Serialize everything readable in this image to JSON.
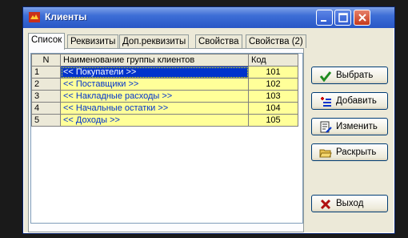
{
  "window": {
    "title": "Клиенты"
  },
  "tabs": [
    {
      "label": "Список"
    },
    {
      "label": "Реквизиты"
    },
    {
      "label": "Доп.реквизиты"
    },
    {
      "label": "Свойства"
    },
    {
      "label": "Свойства (2)"
    }
  ],
  "table": {
    "columns": [
      "N",
      "Наименование группы клиентов",
      "Код"
    ],
    "rows": [
      {
        "n": "1",
        "name": "<< Покупатели >>",
        "code": "101"
      },
      {
        "n": "2",
        "name": "<< Поставщики >>",
        "code": "102"
      },
      {
        "n": "3",
        "name": "<< Накладные расходы >>",
        "code": "103"
      },
      {
        "n": "4",
        "name": "<< Начальные остатки >>",
        "code": "104"
      },
      {
        "n": "5",
        "name": "<< Доходы >>",
        "code": "105"
      }
    ],
    "selected_row": 1
  },
  "buttons": {
    "select": "Выбрать",
    "add": "Добавить",
    "edit": "Изменить",
    "expand": "Раскрыть",
    "exit": "Выход"
  },
  "colors": {
    "row_fill": "#ffff99",
    "selection": "#0033cc",
    "window_bg": "#ece9d8"
  }
}
